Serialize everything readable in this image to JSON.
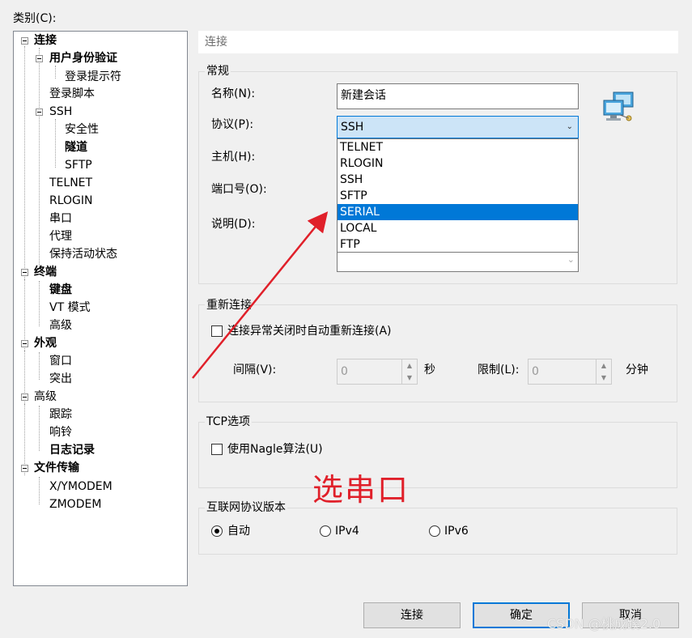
{
  "category_label": "类别(C):",
  "tree": {
    "items": [
      {
        "label": "连接",
        "bold": true
      },
      {
        "label": "用户身份验证",
        "bold": true
      },
      {
        "label": "登录提示符",
        "bold": false
      },
      {
        "label": "登录脚本",
        "bold": false
      },
      {
        "label": "SSH",
        "bold": false
      },
      {
        "label": "安全性",
        "bold": false
      },
      {
        "label": "隧道",
        "bold": true
      },
      {
        "label": "SFTP",
        "bold": false
      },
      {
        "label": "TELNET",
        "bold": false
      },
      {
        "label": "RLOGIN",
        "bold": false
      },
      {
        "label": "串口",
        "bold": false
      },
      {
        "label": "代理",
        "bold": false
      },
      {
        "label": "保持活动状态",
        "bold": false
      },
      {
        "label": "终端",
        "bold": true
      },
      {
        "label": "键盘",
        "bold": true
      },
      {
        "label": "VT 模式",
        "bold": false
      },
      {
        "label": "高级",
        "bold": false
      },
      {
        "label": "外观",
        "bold": true
      },
      {
        "label": "窗口",
        "bold": false
      },
      {
        "label": "突出",
        "bold": false
      },
      {
        "label": "高级",
        "bold": false
      },
      {
        "label": "跟踪",
        "bold": false
      },
      {
        "label": "响铃",
        "bold": false
      },
      {
        "label": "日志记录",
        "bold": true
      },
      {
        "label": "文件传输",
        "bold": true
      },
      {
        "label": "X/YMODEM",
        "bold": false
      },
      {
        "label": "ZMODEM",
        "bold": false
      }
    ]
  },
  "header": {
    "title": "连接"
  },
  "general": {
    "group_title": "常规",
    "name_label": "名称(N):",
    "name_value": "新建会话",
    "protocol_label": "协议(P):",
    "protocol_value": "SSH",
    "host_label": "主机(H):",
    "port_label": "端口号(O):",
    "desc_label": "说明(D):",
    "protocol_options": [
      "TELNET",
      "RLOGIN",
      "SSH",
      "SFTP",
      "SERIAL",
      "LOCAL",
      "FTP"
    ],
    "highlighted_option": "SERIAL"
  },
  "reconnect": {
    "group_title": "重新连接",
    "checkbox_label": "连接异常关闭时自动重新连接(A)",
    "interval_label": "间隔(V):",
    "interval_value": "0",
    "interval_unit": "秒",
    "limit_label": "限制(L):",
    "limit_value": "0",
    "limit_unit": "分钟"
  },
  "tcp": {
    "group_title": "TCP选项",
    "nagle_label": "使用Nagle算法(U)"
  },
  "ipver": {
    "group_title": "互联网协议版本",
    "options": [
      "自动",
      "IPv4",
      "IPv6"
    ],
    "selected": "自动"
  },
  "annotation": "选串口",
  "buttons": {
    "connect": "连接",
    "ok": "确定",
    "cancel": "取消"
  },
  "watermark": "CSDN @桃成蹊2.0",
  "colors": {
    "accent": "#0078d7",
    "annotation": "#e0202a",
    "combo_bg": "#cce4f7"
  }
}
